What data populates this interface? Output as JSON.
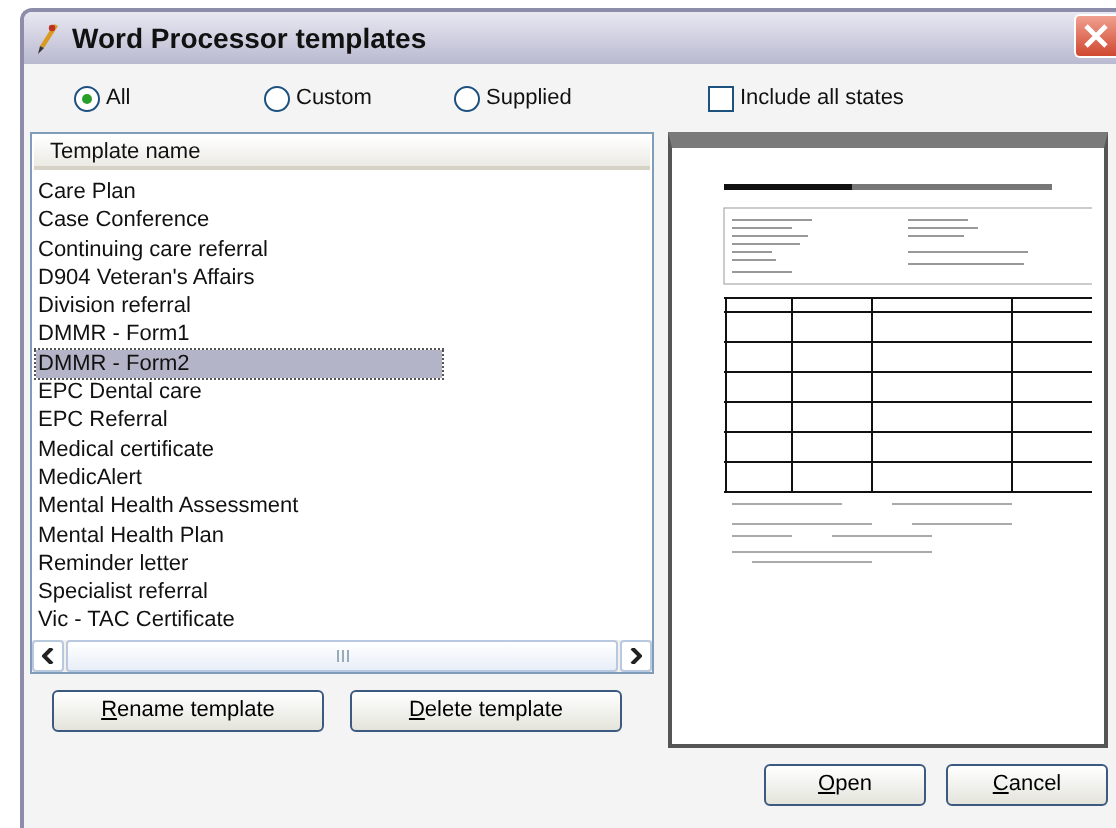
{
  "window": {
    "title": "Word Processor templates"
  },
  "filters": [
    {
      "label": "All",
      "selected": true
    },
    {
      "label": "Custom",
      "selected": false
    },
    {
      "label": "Supplied",
      "selected": false
    }
  ],
  "include_all_states": {
    "label": "Include all states",
    "checked": false
  },
  "table": {
    "columns": [
      "Template name"
    ],
    "rows": [
      {
        "name": "Care Plan",
        "selected": false
      },
      {
        "name": "Case Conference",
        "selected": false
      },
      {
        "name": "Continuing care referral",
        "selected": false
      },
      {
        "name": "D904 Veteran's Affairs",
        "selected": false
      },
      {
        "name": "Division referral",
        "selected": false
      },
      {
        "name": "DMMR - Form1",
        "selected": false
      },
      {
        "name": "DMMR - Form2",
        "selected": true
      },
      {
        "name": "EPC Dental care",
        "selected": false
      },
      {
        "name": "EPC Referral",
        "selected": false
      },
      {
        "name": "Medical certificate",
        "selected": false
      },
      {
        "name": "MedicAlert",
        "selected": false
      },
      {
        "name": "Mental Health Assessment",
        "selected": false
      },
      {
        "name": "Mental Health Plan",
        "selected": false
      },
      {
        "name": "Reminder letter",
        "selected": false
      },
      {
        "name": "Specialist referral",
        "selected": false
      },
      {
        "name": "Vic - TAC Certificate",
        "selected": false
      }
    ]
  },
  "list_buttons": [
    {
      "accel": "R",
      "rest": "ename template"
    },
    {
      "accel": "D",
      "rest": "elete template"
    }
  ],
  "dialog_buttons": [
    {
      "accel": "O",
      "rest": "pen"
    },
    {
      "accel": "C",
      "rest": "ancel"
    }
  ]
}
